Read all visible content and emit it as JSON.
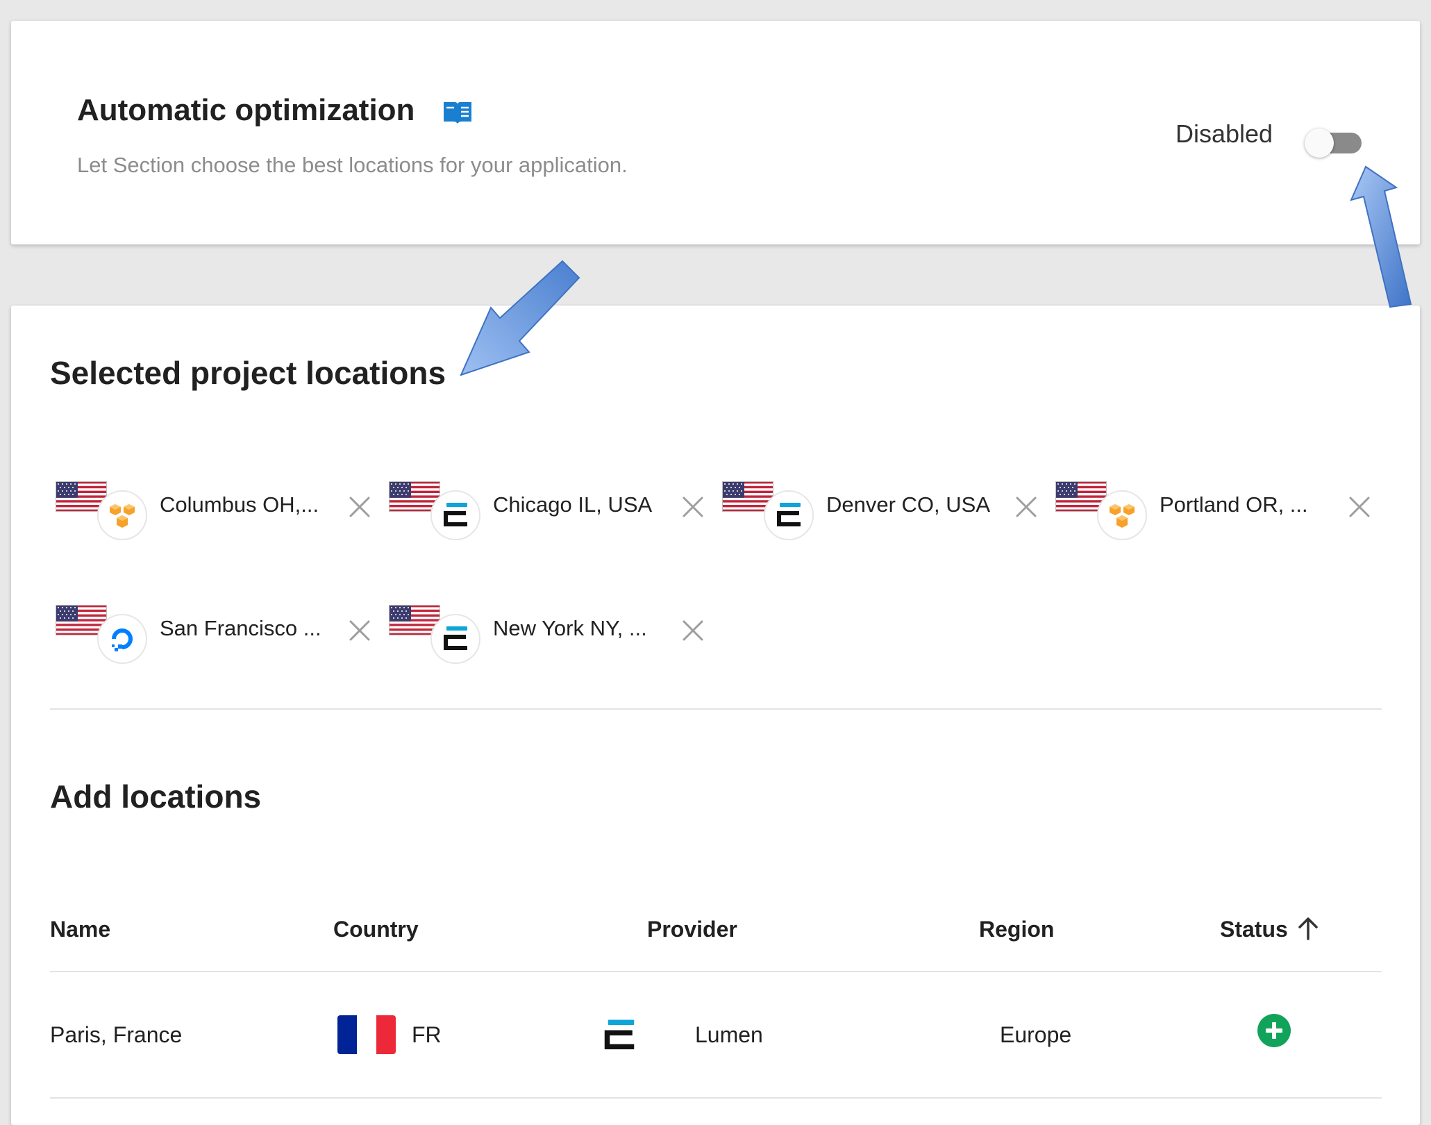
{
  "automatic_optimization": {
    "title": "Automatic optimization",
    "subtitle": "Let Section choose the best locations for your application.",
    "toggle_label": "Disabled",
    "toggle_enabled": false,
    "book_icon": "book-icon"
  },
  "selected": {
    "title": "Selected project locations",
    "chips": [
      {
        "label": "Columbus OH,...",
        "flag": "us-flag-icon",
        "provider_icon": "aws-icon"
      },
      {
        "label": "Chicago IL, USA",
        "flag": "us-flag-icon",
        "provider_icon": "lumen-icon"
      },
      {
        "label": "Denver CO, USA",
        "flag": "us-flag-icon",
        "provider_icon": "lumen-icon"
      },
      {
        "label": "Portland OR, ...",
        "flag": "us-flag-icon",
        "provider_icon": "aws-icon"
      },
      {
        "label": "San Francisco ...",
        "flag": "us-flag-icon",
        "provider_icon": "digitalocean-icon"
      },
      {
        "label": "New York NY, ...",
        "flag": "us-flag-icon",
        "provider_icon": "lumen-icon"
      }
    ],
    "remove_icon": "close-icon"
  },
  "add": {
    "title": "Add locations",
    "columns": [
      "Name",
      "Country",
      "Provider",
      "Region",
      "Status"
    ],
    "sort_icon": "arrow-up-icon",
    "rows": [
      {
        "name": "Paris, France",
        "country_code": "FR",
        "country_flag": "fr-flag-icon",
        "provider": "Lumen",
        "provider_icon": "lumen-icon",
        "region": "Europe",
        "status_icon": "add-circle-icon"
      }
    ]
  },
  "colors": {
    "toggle_off": "#8a8a8a",
    "add_button": "#12a35a",
    "annotation_arrow": "#5b8fdc",
    "book_icon": "#1a7fd1"
  }
}
